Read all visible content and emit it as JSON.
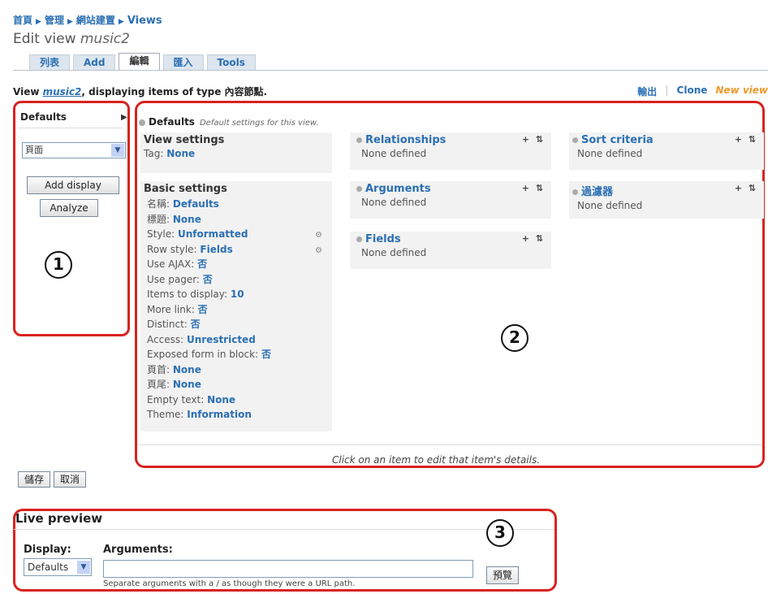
{
  "breadcrumb": [
    "首頁",
    "管理",
    "網站建置",
    "Views"
  ],
  "title": {
    "prefix": "Edit view",
    "name": "music2"
  },
  "tabs": [
    "列表",
    "Add",
    "編輯",
    "匯入",
    "Tools"
  ],
  "active_tab_index": 2,
  "header": {
    "text_prefix": "View",
    "view_name": "music2",
    "text_suffix": ", displaying items of type 內容節點.",
    "links": {
      "export": "輸出",
      "clone": "Clone",
      "new_view": "New view"
    }
  },
  "left": {
    "defaults_label": "Defaults",
    "select_value": "頁面",
    "add_display": "Add display",
    "analyze": "Analyze",
    "marker": "1"
  },
  "main": {
    "head_label": "Defaults",
    "head_desc": "Default settings for this view.",
    "view_settings": {
      "title": "View settings",
      "tag_label": "Tag:",
      "tag_value": "None"
    },
    "basic_settings": {
      "title": "Basic settings",
      "items": [
        {
          "label": "名稱:",
          "value": "Defaults"
        },
        {
          "label": "標題:",
          "value": "None"
        },
        {
          "label": "Style:",
          "value": "Unformatted"
        },
        {
          "label": "Row style:",
          "value": "Fields"
        },
        {
          "label": "Use AJAX:",
          "value": "否"
        },
        {
          "label": "Use pager:",
          "value": "否"
        },
        {
          "label": "Items to display:",
          "value": "10"
        },
        {
          "label": "More link:",
          "value": "否"
        },
        {
          "label": "Distinct:",
          "value": "否"
        },
        {
          "label": "Access:",
          "value": "Unrestricted"
        },
        {
          "label": "Exposed form in block:",
          "value": "否"
        },
        {
          "label": "頁首:",
          "value": "None"
        },
        {
          "label": "頁尾:",
          "value": "None"
        },
        {
          "label": "Empty text:",
          "value": "None"
        },
        {
          "label": "Theme:",
          "value": "Information"
        }
      ]
    },
    "relationships": {
      "title": "Relationships",
      "value": "None defined"
    },
    "arguments": {
      "title": "Arguments",
      "value": "None defined"
    },
    "fields": {
      "title": "Fields",
      "value": "None defined"
    },
    "sort_criteria": {
      "title": "Sort criteria",
      "value": "None defined"
    },
    "filters": {
      "title": "過濾器",
      "value": "None defined"
    },
    "footer_note": "Click on an item to edit that item's details.",
    "marker": "2"
  },
  "actions": {
    "save": "儲存",
    "cancel": "取消"
  },
  "preview": {
    "title": "Live preview",
    "display_label": "Display:",
    "display_value": "Defaults",
    "arguments_label": "Arguments:",
    "arguments_value": "",
    "arguments_desc": "Separate arguments with a / as though they were a URL path.",
    "preview_button": "預覽",
    "marker": "3"
  }
}
